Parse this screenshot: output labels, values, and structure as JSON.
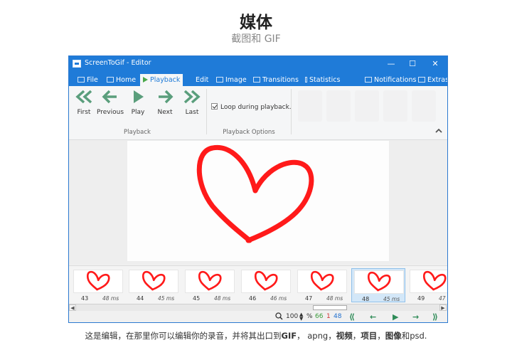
{
  "page": {
    "heading": "媒体",
    "subheading": "截图和 GIF",
    "caption": {
      "p1": "这是编辑，在那里你可以编辑你的录音，并将其出口到",
      "b1": "GIF",
      "p2": "， apng，",
      "b2": "视频",
      "p3": "，",
      "b3": "项目",
      "p4": "，",
      "b4": "图像",
      "p5": "和psd."
    }
  },
  "window": {
    "title": "ScreenToGif - Editor",
    "controls": {
      "minimize": "—",
      "maximize": "☐",
      "close": "✕"
    }
  },
  "tabs": {
    "file": "File",
    "home": "Home",
    "playback": "Playback",
    "edit": "Edit",
    "image": "Image",
    "transitions": "Transitions",
    "statistics": "Statistics",
    "notifications": "Notifications",
    "extras": "Extras"
  },
  "ribbon": {
    "first": "First",
    "previous": "Previous",
    "play": "Play",
    "next": "Next",
    "last": "Last",
    "playback_group": "Playback",
    "loop": "Loop during playback.",
    "options_group": "Playback Options"
  },
  "frames": [
    {
      "num": "43",
      "delay": "48 ms"
    },
    {
      "num": "44",
      "delay": "45 ms"
    },
    {
      "num": "45",
      "delay": "48 ms"
    },
    {
      "num": "46",
      "delay": "46 ms"
    },
    {
      "num": "47",
      "delay": "48 ms"
    },
    {
      "num": "48",
      "delay": "45 ms"
    },
    {
      "num": "49",
      "delay": "47"
    }
  ],
  "status": {
    "zoom": "100",
    "percent": "%",
    "current": "66",
    "selected": "1",
    "total": "48"
  },
  "colors": {
    "accent": "#1f7bd8",
    "heart": "#ff1a1a",
    "nav_green": "#2e8b57",
    "count_green": "#3a9b3a",
    "count_red": "#d03030",
    "count_blue": "#1f6fcf"
  }
}
